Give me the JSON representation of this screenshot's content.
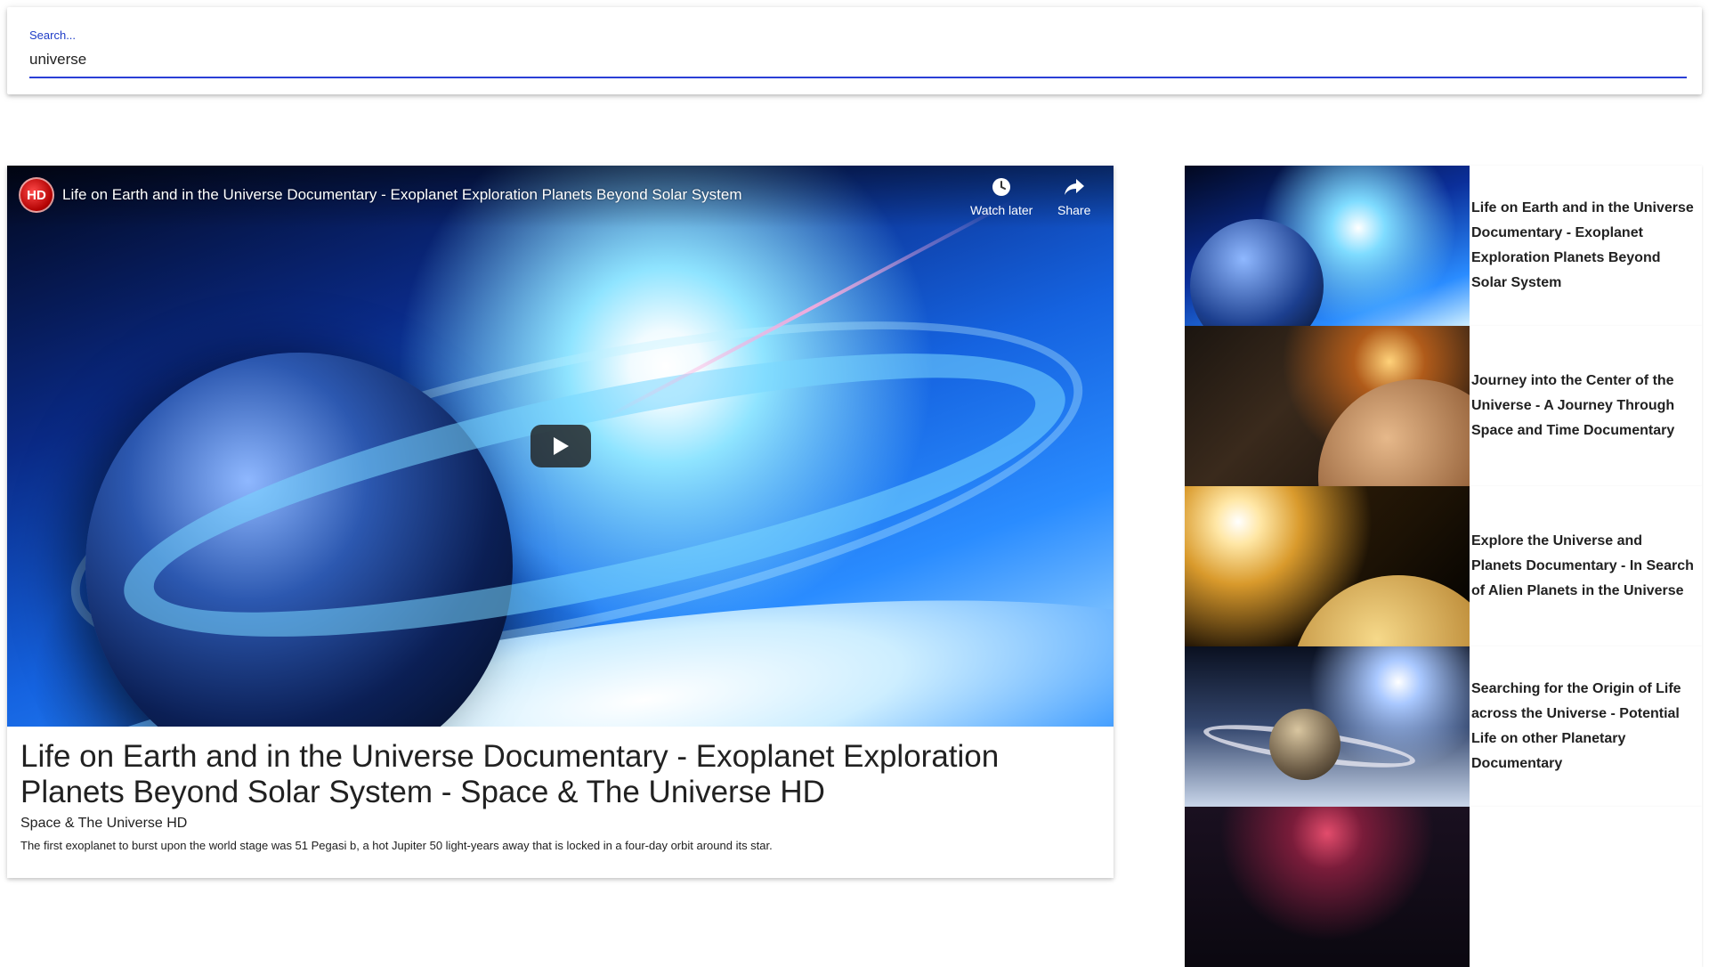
{
  "search": {
    "label": "Search...",
    "value": "universe"
  },
  "player": {
    "channel_logo_text": "HD",
    "title": "Life on Earth and in the Universe Documentary - Exoplanet Exploration Planets Beyond Solar System",
    "watch_later_label": "Watch later",
    "share_label": "Share",
    "icons": {
      "watch_later": "clock-icon",
      "share": "share-arrow-icon",
      "play": "play-icon"
    }
  },
  "video": {
    "title": "Life on Earth and in the Universe Documentary - Exoplanet Exploration Planets Beyond Solar System - Space & The Universe HD",
    "channel": "Space & The Universe HD",
    "description": "The first exoplanet to burst upon the world stage was 51 Pegasi b, a hot Jupiter 50 light-years away that is locked in a four-day orbit around its star."
  },
  "related": [
    {
      "title": "Life on Earth and in the Universe Documentary - Exoplanet Exploration Planets Beyond Solar System"
    },
    {
      "title": "Journey into the Center of the Universe - A Journey Through Space and Time Documentary"
    },
    {
      "title": "Explore the Universe and Planets Documentary - In Search of Alien Planets in the Universe"
    },
    {
      "title": "Searching for the Origin of Life across the Universe - Potential Life on other Planetary Documentary"
    },
    {
      "title": ""
    }
  ],
  "colors": {
    "accent": "#2b3fd6",
    "text": "#212121",
    "background": "#ffffff"
  }
}
